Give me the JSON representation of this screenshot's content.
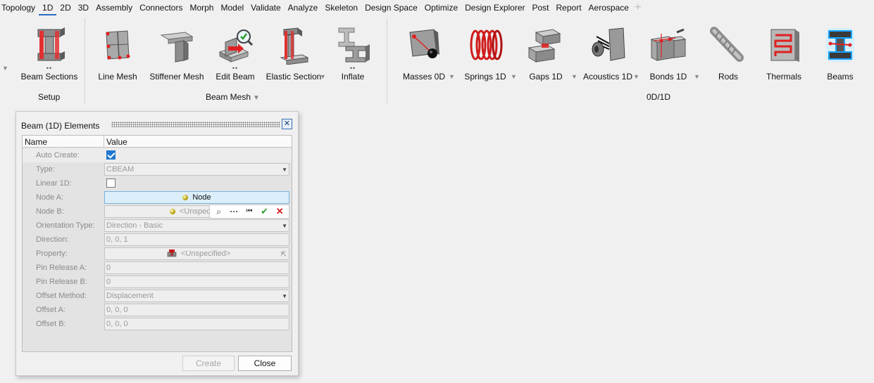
{
  "menu": {
    "tabs": [
      "Topology",
      "1D",
      "2D",
      "3D",
      "Assembly",
      "Connectors",
      "Morph",
      "Model",
      "Validate",
      "Analyze",
      "Skeleton",
      "Design Space",
      "Optimize",
      "Design Explorer",
      "Post",
      "Report",
      "Aerospace"
    ],
    "active_tab": "1D",
    "add_symbol": "+"
  },
  "ribbon": {
    "groups": {
      "setup": "Setup",
      "beam_mesh": "Beam Mesh",
      "zero_one_d": "0D/1D"
    },
    "tools": {
      "beam_sections": "Beam Sections",
      "line_mesh": "Line Mesh",
      "stiffener_mesh": "Stiffener Mesh",
      "edit_beam": "Edit Beam",
      "elastic_section": "Elastic Section",
      "inflate": "Inflate",
      "masses_0d": "Masses 0D",
      "springs_1d": "Springs 1D",
      "gaps_1d": "Gaps 1D",
      "acoustics_1d": "Acoustics 1D",
      "bonds_1d": "Bonds 1D",
      "rods": "Rods",
      "thermals": "Thermals",
      "beams": "Beams"
    },
    "active_tool": "Beams",
    "dots": "••",
    "caret": "▼"
  },
  "dialog": {
    "title": "Beam (1D) Elements",
    "close_symbol": "✕",
    "columns": {
      "name": "Name",
      "value": "Value"
    },
    "rows": {
      "auto_create": {
        "name": "Auto Create:",
        "checked": true
      },
      "type": {
        "name": "Type:",
        "value": "CBEAM"
      },
      "linear_1d": {
        "name": "Linear 1D:",
        "checked": false
      },
      "node_a": {
        "name": "Node A:",
        "value": "Node"
      },
      "node_b": {
        "name": "Node B:",
        "value": "<Unspec"
      },
      "orientation_type": {
        "name": "Orientation Type:",
        "value": "Direction - Basic"
      },
      "direction": {
        "name": "Direction:",
        "value": "0, 0, 1"
      },
      "property": {
        "name": "Property:",
        "value": "<Unspecified>"
      },
      "pin_release_a": {
        "name": "Pin Release A:",
        "value": "0"
      },
      "pin_release_b": {
        "name": "Pin Release B:",
        "value": "0"
      },
      "offset_method": {
        "name": "Offset Method:",
        "value": "Displacement"
      },
      "offset_a": {
        "name": "Offset A:",
        "value": "0, 0, 0"
      },
      "offset_b": {
        "name": "Offset B:",
        "value": "0, 0, 0"
      }
    },
    "mini_toolbar": {
      "search": "⌕",
      "more": "···",
      "first": "⏮",
      "accept": "✔",
      "reject": "✕"
    },
    "buttons": {
      "create": "Create",
      "close": "Close"
    },
    "colors": {
      "node_highlight": "#dbeefa",
      "accept": "#2e9c2e",
      "reject": "#d21f1f"
    }
  }
}
